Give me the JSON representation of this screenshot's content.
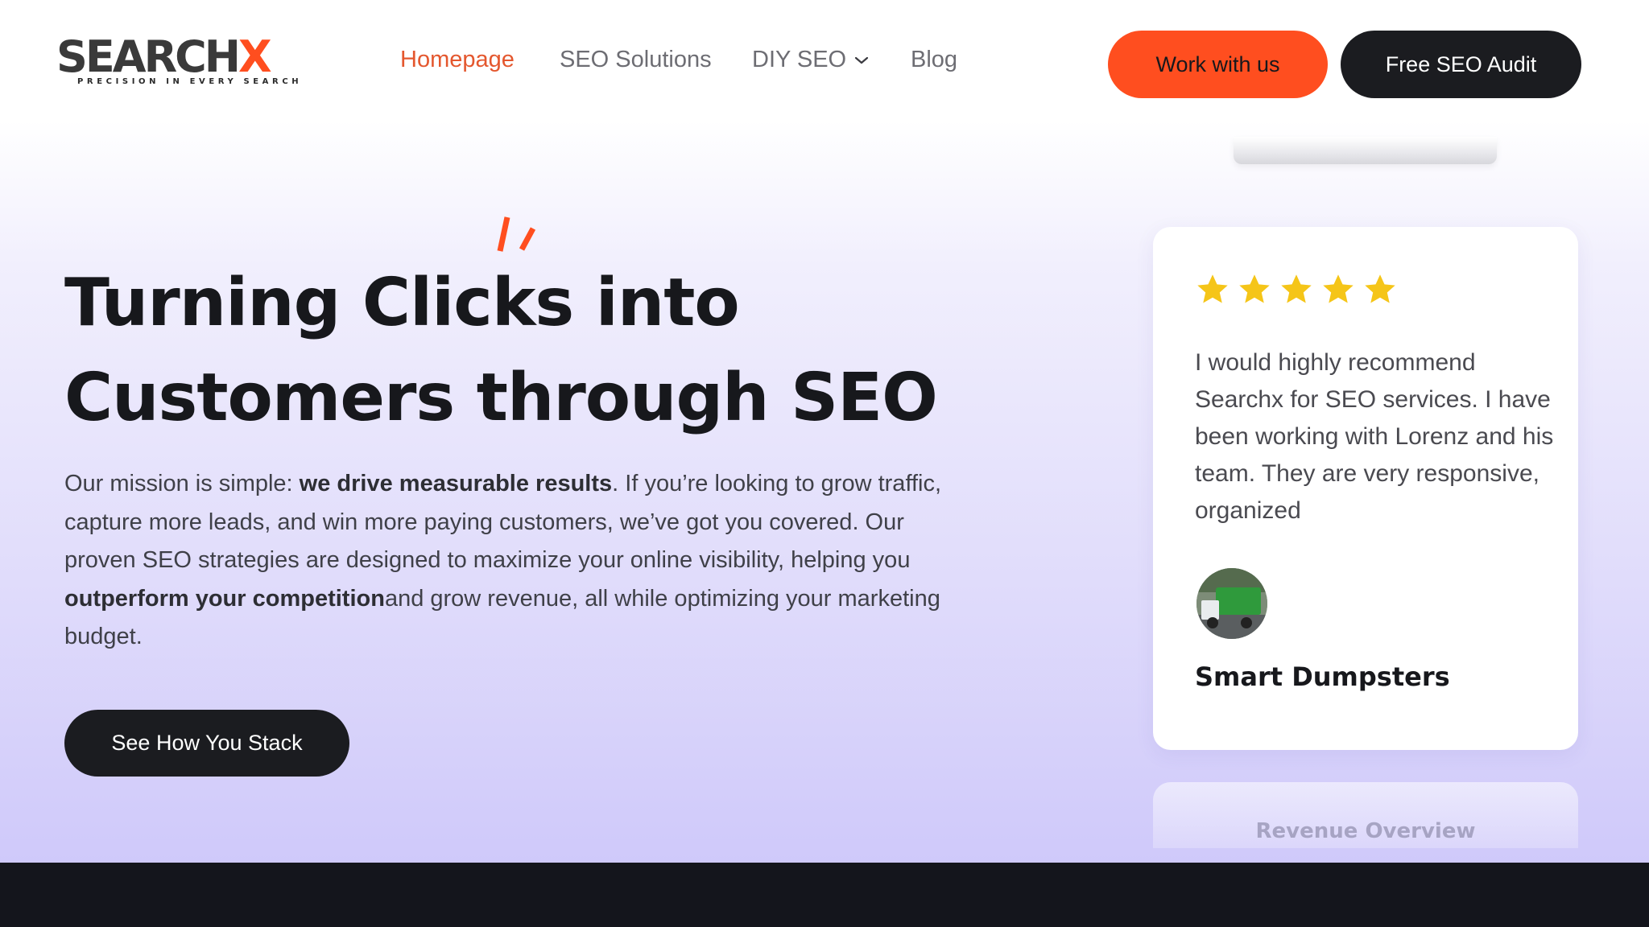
{
  "brand": {
    "name_main": "SEARCH",
    "name_accent": "X",
    "tagline": "PRECISION IN EVERY SEARCH",
    "accent_color": "#ff4e1f"
  },
  "nav": {
    "items": [
      {
        "label": "Homepage",
        "active": true
      },
      {
        "label": "SEO Solutions",
        "active": false
      },
      {
        "label": "DIY SEO",
        "active": false,
        "has_dropdown": true
      },
      {
        "label": "Blog",
        "active": false
      }
    ]
  },
  "header_buttons": {
    "work_with_us": "Work with us",
    "free_audit": "Free SEO Audit"
  },
  "hero": {
    "headline_line1": "Turning Clicks into",
    "headline_line2": "Customers through SEO",
    "mission_intro": "Our mission is simple: ",
    "mission_bold1": "we drive measurable results",
    "mission_mid": ". If you’re looking to grow traffic, capture more leads, and win more paying customers, we’ve got you covered. Our proven SEO strategies are designed to maximize your online visibility, helping you ",
    "mission_bold2": "outperform your competition",
    "mission_end": "and grow revenue, all while optimizing your marketing budget.",
    "cta": "See How You Stack"
  },
  "testimonial": {
    "rating": 5,
    "quote": "I would highly recommend Searchx for SEO services. I have been working with Lorenz and his team. They are very responsive, organized",
    "reviewer": "Smart Dumpsters",
    "star_color": "#f5c518"
  },
  "next_card": {
    "title": "Revenue Overview"
  },
  "colors": {
    "dark": "#1b1c20",
    "footer": "#14151c"
  }
}
